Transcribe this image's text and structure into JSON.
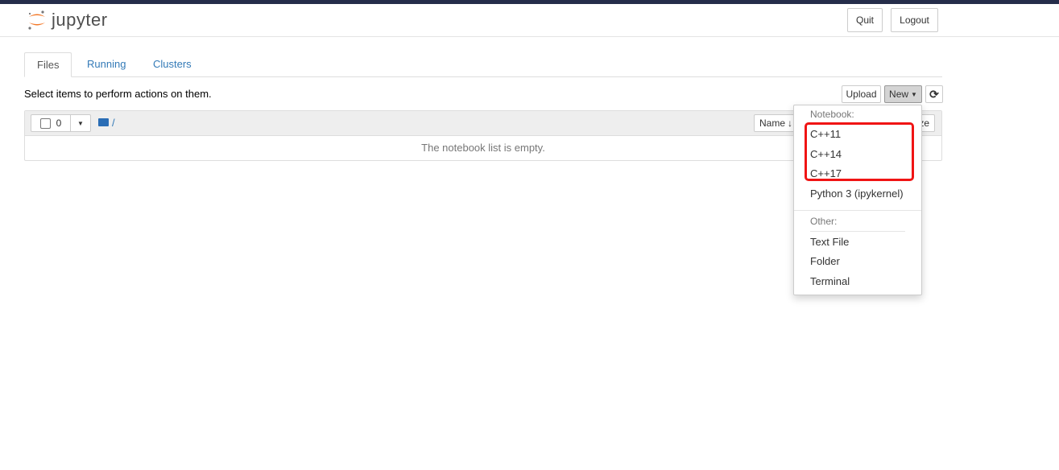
{
  "header": {
    "logo_text": "jupyter",
    "quit_label": "Quit",
    "logout_label": "Logout"
  },
  "tabs": [
    {
      "label": "Files",
      "active": true
    },
    {
      "label": "Running"
    },
    {
      "label": "Clusters"
    }
  ],
  "toolbar": {
    "hint": "Select items to perform actions on them.",
    "upload_label": "Upload",
    "new_label": "New",
    "refresh_icon": "refresh-icon"
  },
  "list": {
    "selected_count": "0",
    "path": "/",
    "sort_name_label": "Name",
    "size_label": "File size",
    "empty_message": "The notebook list is empty."
  },
  "new_menu": {
    "notebook_header": "Notebook:",
    "notebooks": [
      "C++11",
      "C++14",
      "C++17",
      "Python 3 (ipykernel)"
    ],
    "other_header": "Other:",
    "other": [
      "Text File",
      "Folder",
      "Terminal"
    ]
  },
  "colors": {
    "accent": "#337ab7",
    "logo_orange": "#f37726",
    "highlight": "#f01414"
  }
}
